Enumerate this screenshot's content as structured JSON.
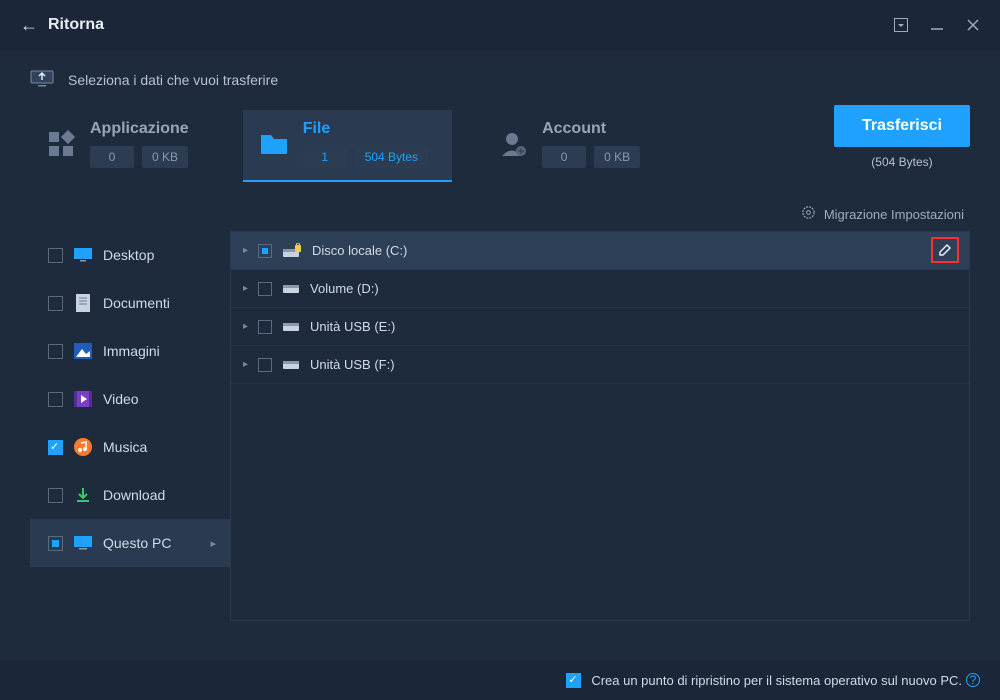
{
  "titlebar": {
    "back": "←",
    "title": "Ritorna"
  },
  "subheader": {
    "text": "Seleziona i dati che vuoi trasferire"
  },
  "tabs": {
    "application": {
      "label": "Applicazione",
      "count": "0",
      "size": "0 KB"
    },
    "file": {
      "label": "File",
      "count": "1",
      "size": "504 Bytes"
    },
    "account": {
      "label": "Account",
      "count": "0",
      "size": "0 KB"
    }
  },
  "transfer": {
    "button": "Trasferisci",
    "sub": "(504 Bytes)"
  },
  "settings_link": "Migrazione Impostazioni",
  "sidebar": [
    {
      "label": "Desktop",
      "checked": false,
      "indeterminate": false
    },
    {
      "label": "Documenti",
      "checked": false,
      "indeterminate": false
    },
    {
      "label": "Immagini",
      "checked": false,
      "indeterminate": false
    },
    {
      "label": "Video",
      "checked": false,
      "indeterminate": false
    },
    {
      "label": "Musica",
      "checked": true,
      "indeterminate": false
    },
    {
      "label": "Download",
      "checked": false,
      "indeterminate": false
    },
    {
      "label": "Questo PC",
      "checked": false,
      "indeterminate": true,
      "active": true
    }
  ],
  "drives": [
    {
      "label": "Disco locale (C:)",
      "selected": true,
      "indeterminate": true,
      "type": "disk-locked"
    },
    {
      "label": "Volume (D:)",
      "selected": false,
      "indeterminate": false,
      "type": "disk"
    },
    {
      "label": "Unità USB (E:)",
      "selected": false,
      "indeterminate": false,
      "type": "usb"
    },
    {
      "label": "Unità USB (F:)",
      "selected": false,
      "indeterminate": false,
      "type": "usb"
    }
  ],
  "footer": {
    "label": "Crea un punto di ripristino per il sistema operativo sul nuovo PC."
  }
}
